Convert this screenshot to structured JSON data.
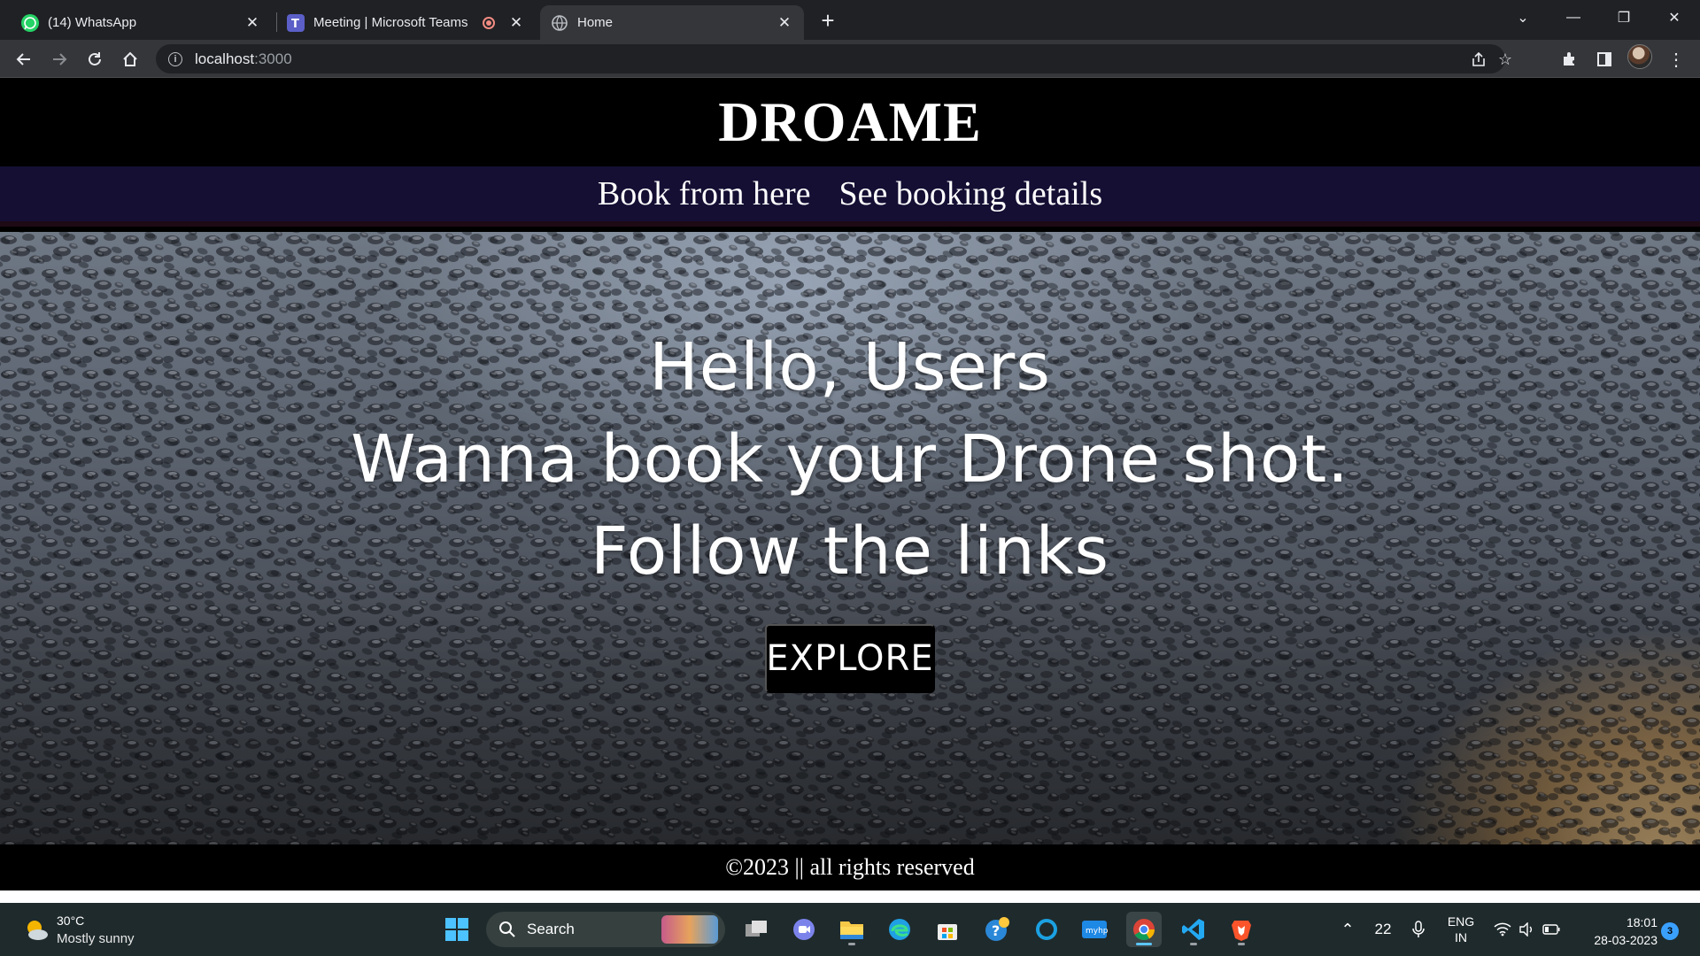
{
  "browser": {
    "tabs": [
      {
        "title": "(14) WhatsApp",
        "favicon": "whatsapp-icon",
        "active": false
      },
      {
        "title": "Meeting | Microsoft Teams",
        "favicon": "teams-icon",
        "active": false,
        "recording": true
      },
      {
        "title": "Home",
        "favicon": "globe-icon",
        "active": true
      }
    ],
    "address": {
      "host": "localhost",
      "port": ":3000"
    }
  },
  "site": {
    "brand": "DROAME",
    "nav": [
      {
        "label": "Book from here"
      },
      {
        "label": "See booking details"
      }
    ],
    "hero": {
      "line1": "Hello, Users",
      "line2": "Wanna book your Drone shot.",
      "line3": "Follow the links",
      "button": "EXPLORE"
    },
    "footer": "©2023 || all rights reserved",
    "colors": {
      "header": "#000000",
      "navbar": "#140f33",
      "button": "#000000",
      "text": "#ffffff"
    }
  },
  "taskbar": {
    "weather": {
      "temp": "30°C",
      "desc": "Mostly sunny"
    },
    "search_label": "Search",
    "tray": {
      "count": "22",
      "lang": "ENG",
      "region": "IN"
    },
    "clock": {
      "time": "18:01",
      "date": "28-03-2023"
    },
    "notifications": "3"
  }
}
